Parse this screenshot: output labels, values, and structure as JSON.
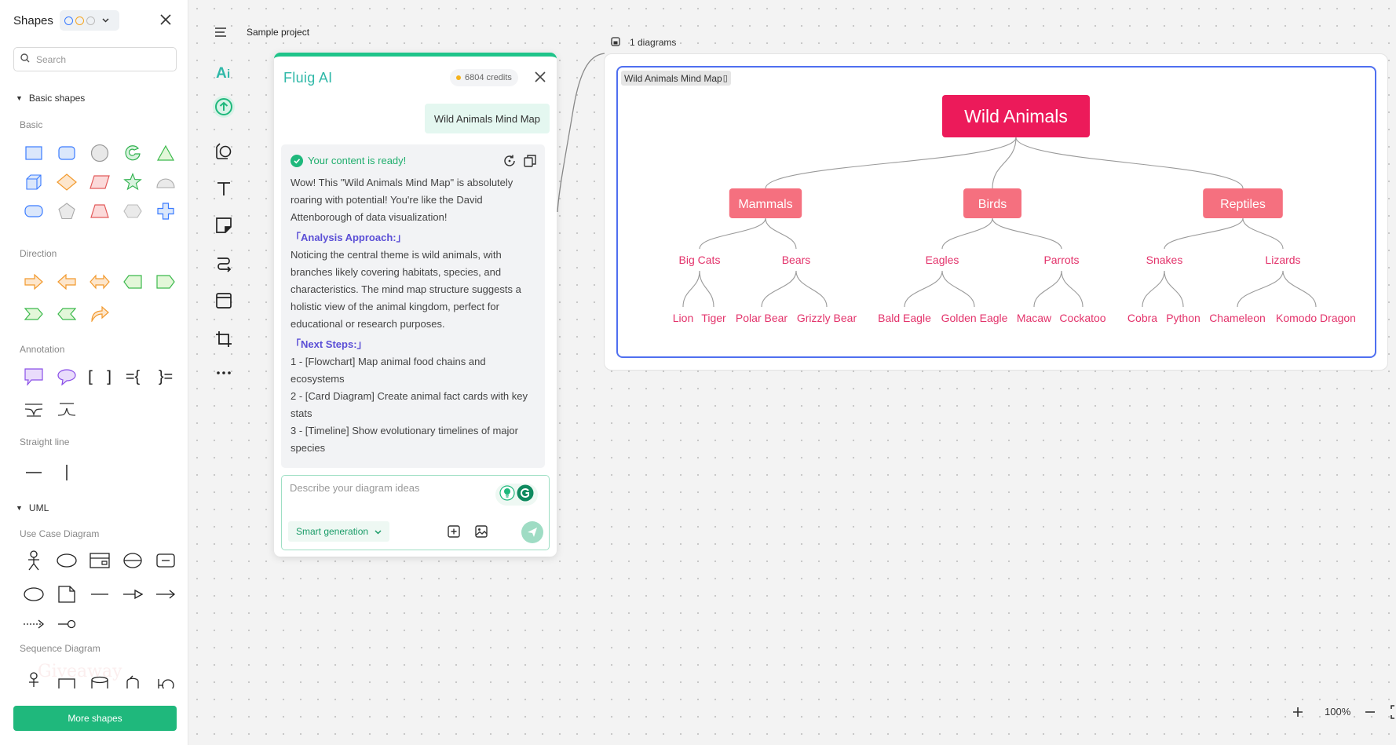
{
  "shapes_panel": {
    "title": "Shapes",
    "search_placeholder": "Search",
    "sections": {
      "basic_shapes": "Basic shapes",
      "uml": "UML"
    },
    "categories": {
      "basic": "Basic",
      "direction": "Direction",
      "annotation": "Annotation",
      "straight_line": "Straight line",
      "use_case": "Use Case Diagram",
      "sequence": "Sequence Diagram"
    },
    "annotation_glyphs": {
      "brackets": "[ ]",
      "brace_eq_left": "={",
      "brace_eq_right": "}="
    },
    "more_shapes_label": "More shapes",
    "watermark": "Giveaway"
  },
  "topbar": {
    "project_name": "Sample project"
  },
  "ai_panel": {
    "title": "Fluig AI",
    "credits": "6804 credits",
    "user_message": "Wild Animals Mind Map",
    "ready_text": "Your content is ready!",
    "intro": "Wow! This \"Wild Animals Mind Map\" is absolutely roaring with potential! You're like the David Attenborough of data visualization!",
    "analysis_heading": "「Analysis Approach:」",
    "analysis_text": "Noticing the central theme is wild animals, with branches likely covering habitats, species, and characteristics. The mind map structure suggests a holistic view of the animal kingdom, perfect for educational or research purposes.",
    "next_heading": "「Next Steps:」",
    "steps": [
      "1 - [Flowchart] Map animal food chains and ecosystems",
      "2 - [Card Diagram] Create animal fact cards with key stats",
      "3 - [Timeline] Show evolutionary timelines of major species"
    ],
    "input_placeholder": "Describe your diagram ideas",
    "mode": "Smart generation"
  },
  "canvas": {
    "diagram_count": "1 diagrams",
    "frame_label": "Wild Animals Mind Map",
    "mind_map": {
      "root": "Wild Animals",
      "branches": [
        {
          "label": "Mammals",
          "children": [
            {
              "label": "Big Cats",
              "leaves": [
                "Lion",
                "Tiger"
              ]
            },
            {
              "label": "Bears",
              "leaves": [
                "Polar Bear",
                "Grizzly Bear"
              ]
            }
          ]
        },
        {
          "label": "Birds",
          "children": [
            {
              "label": "Eagles",
              "leaves": [
                "Bald Eagle",
                "Golden Eagle"
              ]
            },
            {
              "label": "Parrots",
              "leaves": [
                "Macaw",
                "Cockatoo"
              ]
            }
          ]
        },
        {
          "label": "Reptiles",
          "children": [
            {
              "label": "Snakes",
              "leaves": [
                "Cobra",
                "Python"
              ]
            },
            {
              "label": "Lizards",
              "leaves": [
                "Chameleon",
                "Komodo Dragon"
              ]
            }
          ]
        }
      ]
    },
    "colors": {
      "root_fill": "#ec1a5a",
      "branch_fill": "#f5707f",
      "text_accent": "#e3336b",
      "selection": "#4f6ff0"
    }
  },
  "zoom": {
    "level": "100%"
  },
  "colors": {
    "accent": "#1fb87c",
    "ai_title": "#2fb8a8",
    "heading_purple": "#5b4fd6"
  }
}
